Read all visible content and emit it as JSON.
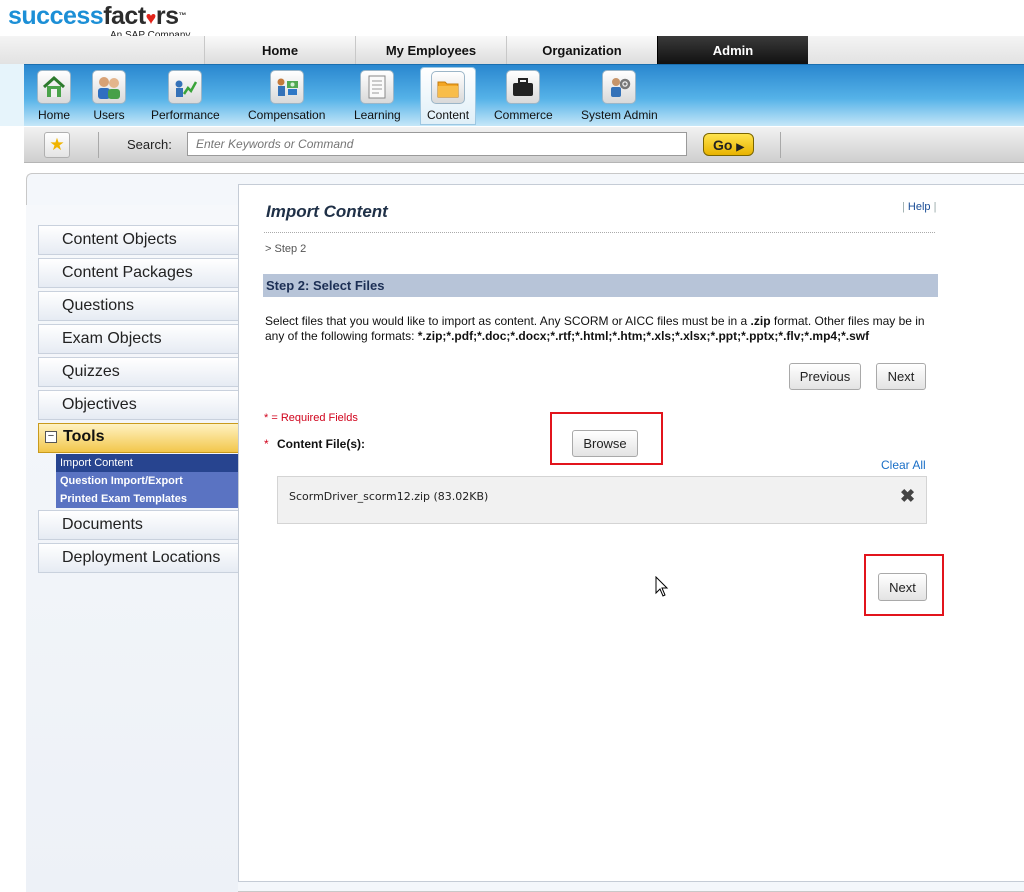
{
  "brand": {
    "name_part1": "success",
    "name_part2": "fact",
    "name_part3": "rs",
    "trademark": "™",
    "sub": "An SAP Company"
  },
  "topnav": {
    "items": [
      {
        "label": "Home"
      },
      {
        "label": "My Employees"
      },
      {
        "label": "Organization"
      },
      {
        "label": "Admin"
      }
    ]
  },
  "modules": {
    "items": [
      {
        "label": "Home",
        "icon": "home-icon"
      },
      {
        "label": "Users",
        "icon": "users-icon"
      },
      {
        "label": "Performance",
        "icon": "performance-icon"
      },
      {
        "label": "Compensation",
        "icon": "compensation-icon"
      },
      {
        "label": "Learning",
        "icon": "learning-icon"
      },
      {
        "label": "Content",
        "icon": "content-folder-icon"
      },
      {
        "label": "Commerce",
        "icon": "commerce-briefcase-icon"
      },
      {
        "label": "System Admin",
        "icon": "system-admin-icon"
      }
    ]
  },
  "search": {
    "label": "Search:",
    "placeholder": "Enter Keywords or Command",
    "go_label": "Go"
  },
  "sidebar": {
    "items": [
      {
        "label": "Content Objects"
      },
      {
        "label": "Content Packages"
      },
      {
        "label": "Questions"
      },
      {
        "label": "Exam Objects"
      },
      {
        "label": "Quizzes"
      },
      {
        "label": "Objectives"
      }
    ],
    "tools": {
      "label": "Tools",
      "toggle": "−",
      "subitems": [
        {
          "label": "Import Content"
        },
        {
          "label": "Question Import/Export"
        },
        {
          "label": "Printed Exam Templates"
        }
      ]
    },
    "after_items": [
      {
        "label": "Documents"
      },
      {
        "label": "Deployment Locations"
      }
    ]
  },
  "main": {
    "title": "Import Content",
    "help_sep_left": "|",
    "help_label": "Help",
    "help_sep_right": "|",
    "breadcrumb": "> Step 2",
    "step_heading": "Step 2: Select Files",
    "description_part1": "Select files that you would like to import as content. Any SCORM or AICC files must be in a ",
    "description_zip": ".zip",
    "description_part2": " format. Other files may be in any of the following formats: ",
    "description_formats": "*.zip;*.pdf;*.doc;*.docx;*.rtf;*.html;*.htm;*.xls;*.xlsx;*.ppt;*.pptx;*.flv;*.mp4;*.swf",
    "previous_label": "Previous",
    "next_label": "Next",
    "required_note": "* = Required Fields",
    "required_star": "*",
    "content_file_label": "Content File(s):",
    "browse_label": "Browse",
    "clear_all_label": "Clear All",
    "file_name": "ScormDriver_scorm12.zip (83.02KB)",
    "remove_glyph": "✖",
    "next_bottom_label": "Next"
  },
  "colors": {
    "accent_blue": "#1c8fd6",
    "highlight_red": "#e2141c",
    "go_yellow": "#f2c200",
    "step_bar": "#b7c4d8",
    "subnav": "#5a73c2"
  }
}
